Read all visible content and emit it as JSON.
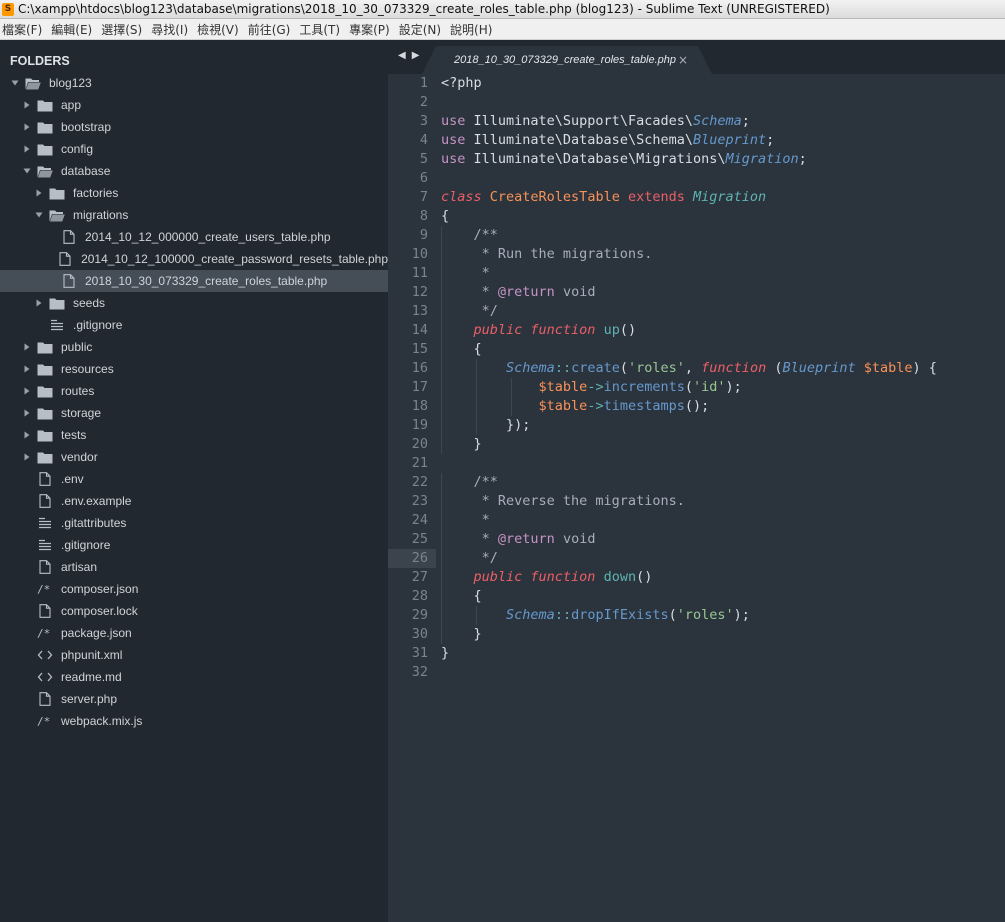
{
  "window": {
    "title": "C:\\xampp\\htdocs\\blog123\\database\\migrations\\2018_10_30_073329_create_roles_table.php (blog123) - Sublime Text (UNREGISTERED)"
  },
  "menu": [
    "檔案(F)",
    "編輯(E)",
    "選擇(S)",
    "尋找(I)",
    "檢視(V)",
    "前往(G)",
    "工具(T)",
    "專案(P)",
    "設定(N)",
    "說明(H)"
  ],
  "sidebar": {
    "header": "FOLDERS",
    "items": [
      {
        "label": "blog123",
        "depth": 0,
        "type": "folder",
        "open": true
      },
      {
        "label": "app",
        "depth": 1,
        "type": "folder",
        "open": false
      },
      {
        "label": "bootstrap",
        "depth": 1,
        "type": "folder",
        "open": false
      },
      {
        "label": "config",
        "depth": 1,
        "type": "folder",
        "open": false
      },
      {
        "label": "database",
        "depth": 1,
        "type": "folder",
        "open": true
      },
      {
        "label": "factories",
        "depth": 2,
        "type": "folder",
        "open": false
      },
      {
        "label": "migrations",
        "depth": 2,
        "type": "folder",
        "open": true
      },
      {
        "label": "2014_10_12_000000_create_users_table.php",
        "depth": 3,
        "type": "file"
      },
      {
        "label": "2014_10_12_100000_create_password_resets_table.php",
        "depth": 3,
        "type": "file"
      },
      {
        "label": "2018_10_30_073329_create_roles_table.php",
        "depth": 3,
        "type": "file",
        "selected": true
      },
      {
        "label": "seeds",
        "depth": 2,
        "type": "folder",
        "open": false
      },
      {
        "label": ".gitignore",
        "depth": 2,
        "type": "lines"
      },
      {
        "label": "public",
        "depth": 1,
        "type": "folder",
        "open": false
      },
      {
        "label": "resources",
        "depth": 1,
        "type": "folder",
        "open": false
      },
      {
        "label": "routes",
        "depth": 1,
        "type": "folder",
        "open": false
      },
      {
        "label": "storage",
        "depth": 1,
        "type": "folder",
        "open": false
      },
      {
        "label": "tests",
        "depth": 1,
        "type": "folder",
        "open": false
      },
      {
        "label": "vendor",
        "depth": 1,
        "type": "folder",
        "open": false
      },
      {
        "label": ".env",
        "depth": 1,
        "type": "file"
      },
      {
        "label": ".env.example",
        "depth": 1,
        "type": "file"
      },
      {
        "label": ".gitattributes",
        "depth": 1,
        "type": "lines"
      },
      {
        "label": ".gitignore",
        "depth": 1,
        "type": "lines"
      },
      {
        "label": "artisan",
        "depth": 1,
        "type": "file"
      },
      {
        "label": "composer.json",
        "depth": 1,
        "type": "comment"
      },
      {
        "label": "composer.lock",
        "depth": 1,
        "type": "file"
      },
      {
        "label": "package.json",
        "depth": 1,
        "type": "comment"
      },
      {
        "label": "phpunit.xml",
        "depth": 1,
        "type": "markup"
      },
      {
        "label": "readme.md",
        "depth": 1,
        "type": "markup"
      },
      {
        "label": "server.php",
        "depth": 1,
        "type": "file"
      },
      {
        "label": "webpack.mix.js",
        "depth": 1,
        "type": "comment"
      }
    ]
  },
  "tabs": {
    "nav_back": "◀",
    "nav_forward": "▶",
    "active_label": "2018_10_30_073329_create_roles_table.php",
    "close": "×"
  },
  "editor": {
    "current_line": 26,
    "lines": [
      {
        "n": "1",
        "tokens": [
          [
            "plain",
            "<?php"
          ]
        ]
      },
      {
        "n": "2",
        "tokens": []
      },
      {
        "n": "3",
        "tokens": [
          [
            "kw",
            "use "
          ],
          [
            "plain",
            "Illuminate\\Support\\Facades\\"
          ],
          [
            "cls",
            "Schema"
          ],
          [
            "punct",
            ";"
          ]
        ]
      },
      {
        "n": "4",
        "tokens": [
          [
            "kw",
            "use "
          ],
          [
            "plain",
            "Illuminate\\Database\\Schema\\"
          ],
          [
            "cls",
            "Blueprint"
          ],
          [
            "punct",
            ";"
          ]
        ]
      },
      {
        "n": "5",
        "tokens": [
          [
            "kw",
            "use "
          ],
          [
            "plain",
            "Illuminate\\Database\\Migrations\\"
          ],
          [
            "cls",
            "Migration"
          ],
          [
            "punct",
            ";"
          ]
        ]
      },
      {
        "n": "6",
        "tokens": []
      },
      {
        "n": "7",
        "tokens": [
          [
            "decl",
            "class "
          ],
          [
            "cname",
            "CreateRolesTable "
          ],
          [
            "ext",
            "extends "
          ],
          [
            "parent",
            "Migration"
          ]
        ]
      },
      {
        "n": "8",
        "tokens": [
          [
            "punct",
            "{"
          ]
        ]
      },
      {
        "n": "9",
        "indent": 1,
        "tokens": [
          [
            "comment",
            "    /**"
          ]
        ]
      },
      {
        "n": "10",
        "indent": 1,
        "tokens": [
          [
            "comment",
            "     * Run the migrations."
          ]
        ]
      },
      {
        "n": "11",
        "indent": 1,
        "tokens": [
          [
            "comment",
            "     *"
          ]
        ]
      },
      {
        "n": "12",
        "indent": 1,
        "tokens": [
          [
            "comment",
            "     * "
          ],
          [
            "doctag",
            "@return"
          ],
          [
            "comment",
            " void"
          ]
        ]
      },
      {
        "n": "13",
        "indent": 1,
        "tokens": [
          [
            "comment",
            "     */"
          ]
        ]
      },
      {
        "n": "14",
        "indent": 1,
        "tokens": [
          [
            "decl",
            "    public "
          ],
          [
            "decl",
            "function "
          ],
          [
            "fn",
            "up"
          ],
          [
            "paren",
            "()"
          ]
        ]
      },
      {
        "n": "15",
        "indent": 1,
        "tokens": [
          [
            "punct",
            "    {"
          ]
        ]
      },
      {
        "n": "16",
        "indent": 2,
        "tokens": [
          [
            "plain",
            "        "
          ],
          [
            "cls",
            "Schema"
          ],
          [
            "op",
            "::"
          ],
          [
            "func",
            "create"
          ],
          [
            "paren",
            "("
          ],
          [
            "str",
            "'roles'"
          ],
          [
            "punct",
            ", "
          ],
          [
            "decl",
            "function "
          ],
          [
            "paren",
            "("
          ],
          [
            "cls",
            "Blueprint "
          ],
          [
            "var",
            "$table"
          ],
          [
            "paren",
            ") {"
          ]
        ]
      },
      {
        "n": "17",
        "indent": 3,
        "tokens": [
          [
            "plain",
            "            "
          ],
          [
            "var",
            "$table"
          ],
          [
            "op",
            "->"
          ],
          [
            "func",
            "increments"
          ],
          [
            "paren",
            "("
          ],
          [
            "str",
            "'id'"
          ],
          [
            "paren",
            ");"
          ]
        ]
      },
      {
        "n": "18",
        "indent": 3,
        "tokens": [
          [
            "plain",
            "            "
          ],
          [
            "var",
            "$table"
          ],
          [
            "op",
            "->"
          ],
          [
            "func",
            "timestamps"
          ],
          [
            "paren",
            "();"
          ]
        ]
      },
      {
        "n": "19",
        "indent": 2,
        "tokens": [
          [
            "punct",
            "        });"
          ]
        ]
      },
      {
        "n": "20",
        "indent": 1,
        "tokens": [
          [
            "punct",
            "    }"
          ]
        ]
      },
      {
        "n": "21",
        "tokens": []
      },
      {
        "n": "22",
        "indent": 1,
        "tokens": [
          [
            "comment",
            "    /**"
          ]
        ]
      },
      {
        "n": "23",
        "indent": 1,
        "tokens": [
          [
            "comment",
            "     * Reverse the migrations."
          ]
        ]
      },
      {
        "n": "24",
        "indent": 1,
        "tokens": [
          [
            "comment",
            "     *"
          ]
        ]
      },
      {
        "n": "25",
        "indent": 1,
        "tokens": [
          [
            "comment",
            "     * "
          ],
          [
            "doctag",
            "@return"
          ],
          [
            "comment",
            " void"
          ]
        ]
      },
      {
        "n": "26",
        "indent": 1,
        "tokens": [
          [
            "comment",
            "     */"
          ]
        ]
      },
      {
        "n": "27",
        "indent": 1,
        "tokens": [
          [
            "decl",
            "    public "
          ],
          [
            "decl",
            "function "
          ],
          [
            "fn",
            "down"
          ],
          [
            "paren",
            "()"
          ]
        ]
      },
      {
        "n": "28",
        "indent": 1,
        "tokens": [
          [
            "punct",
            "    {"
          ]
        ]
      },
      {
        "n": "29",
        "indent": 2,
        "tokens": [
          [
            "plain",
            "        "
          ],
          [
            "cls",
            "Schema"
          ],
          [
            "op",
            "::"
          ],
          [
            "func",
            "dropIfExists"
          ],
          [
            "paren",
            "("
          ],
          [
            "str",
            "'roles'"
          ],
          [
            "paren",
            ");"
          ]
        ]
      },
      {
        "n": "30",
        "indent": 1,
        "tokens": [
          [
            "punct",
            "    }"
          ]
        ]
      },
      {
        "n": "31",
        "tokens": [
          [
            "punct",
            "}"
          ]
        ]
      },
      {
        "n": "32",
        "tokens": []
      }
    ]
  }
}
